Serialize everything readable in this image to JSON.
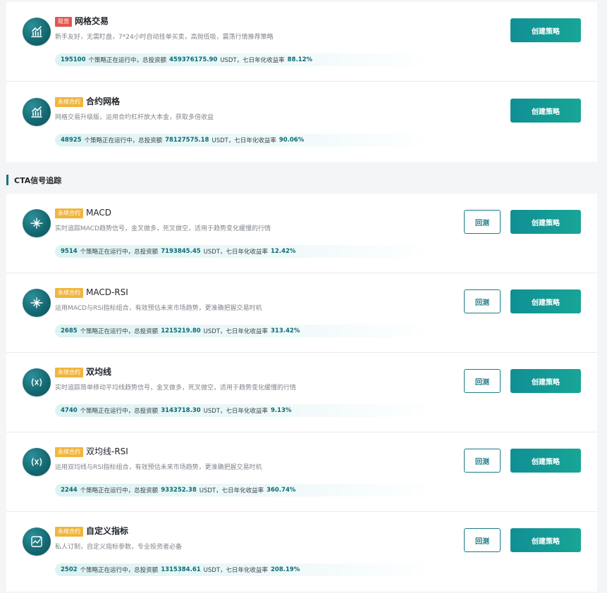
{
  "section": {
    "title": "CTA信号追踪"
  },
  "buttons": {
    "create": "创建策略",
    "backtest": "回测"
  },
  "grid_strategies": [
    {
      "tag": "现货",
      "title": "网格交易",
      "description": "新手友好，无需盯盘，7*24小时自动挂单买卖，高抛低吸，震荡行情推荐策略",
      "running_count": "195100",
      "running_text": "个策略正在运行中，总投资额",
      "total_investment": "459376175.90",
      "currency_text": "USDT，七日年化收益率",
      "apy": "88.12%"
    },
    {
      "tag": "永续合约",
      "title": "合约网格",
      "description": "网格交易升级版，运用合约杠杆放大本金，获取多倍收益",
      "running_count": "48925",
      "running_text": "个策略正在运行中，总投资额",
      "total_investment": "78127575.18",
      "currency_text": "USDT，七日年化收益率",
      "apy": "90.06%"
    }
  ],
  "cta_strategies": [
    {
      "tag": "永续合约",
      "title": "MACD",
      "description": "实时追踪MACD趋势信号，金叉做多，死叉做空，适用于趋势变化缓慢的行情",
      "running_count": "9514",
      "running_text": "个策略正在运行中，总投资额",
      "total_investment": "7193845.45",
      "currency_text": "USDT，七日年化收益率",
      "apy": "12.42%"
    },
    {
      "tag": "永续合约",
      "title": "MACD-RSI",
      "description": "运用MACD与RSI指标组合，有效预估未来市场趋势，更准确把握交易时机",
      "running_count": "2685",
      "running_text": "个策略正在运行中，总投资额",
      "total_investment": "1215219.80",
      "currency_text": "USDT，七日年化收益率",
      "apy": "313.42%"
    },
    {
      "tag": "永续合约",
      "title": "双均线",
      "description": "实时追踪简单移动平均线趋势信号，金叉做多，死叉做空，适用于趋势变化缓慢的行情",
      "running_count": "4740",
      "running_text": "个策略正在运行中，总投资额",
      "total_investment": "3143718.30",
      "currency_text": "USDT，七日年化收益率",
      "apy": "9.13%"
    },
    {
      "tag": "永续合约",
      "title": "双均线-RSI",
      "description": "运用双均线与RSI指标组合，有效预估未来市场趋势，更准确把握交易时机",
      "running_count": "2244",
      "running_text": "个策略正在运行中，总投资额",
      "total_investment": "933252.38",
      "currency_text": "USDT，七日年化收益率",
      "apy": "360.74%"
    },
    {
      "tag": "永续合约",
      "title": "自定义指标",
      "description": "私人订制，自定义指标参数，专业投资者必备",
      "running_count": "2502",
      "running_text": "个策略正在运行中，总投资额",
      "total_investment": "1315384.61",
      "currency_text": "USDT，七日年化收益率",
      "apy": "208.19%"
    }
  ],
  "colors": {
    "accent": "#108f95",
    "tag_spot": "#e0574f",
    "tag_perp": "#f0b53d",
    "stat_number": "#0a6b73"
  },
  "icons": {
    "grid": "bar-chart-icon",
    "macd": "crosshair-icon",
    "ma": "signal-wave-icon",
    "custom": "custom-indicator-icon"
  }
}
